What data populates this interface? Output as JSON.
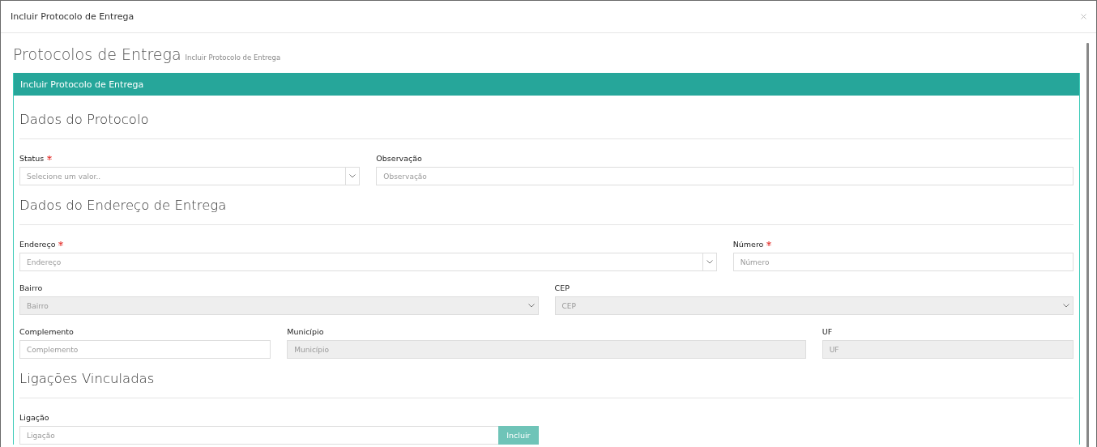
{
  "window": {
    "title": "Incluir Protocolo de Entrega"
  },
  "page": {
    "title": "Protocolos de Entrega",
    "subtitle": "Incluir Protocolo de Entrega"
  },
  "panel": {
    "title": "Incluir Protocolo de Entrega"
  },
  "sections": [
    {
      "title": "Dados do Protocolo",
      "fields": [
        {
          "label": "Status",
          "required": true,
          "kind": "select",
          "placeholder": "Selecione um valor..",
          "disabled": false
        },
        {
          "label": "Observação",
          "required": false,
          "kind": "text",
          "placeholder": "Observação",
          "disabled": false
        }
      ]
    },
    {
      "title": "Dados do Endereço de Entrega",
      "fields": [
        {
          "label": "Endereço",
          "required": true,
          "kind": "select",
          "placeholder": "Endereço",
          "disabled": false
        },
        {
          "label": "Número",
          "required": true,
          "kind": "text",
          "placeholder": "Número",
          "disabled": false
        },
        {
          "label": "Bairro",
          "required": false,
          "kind": "select",
          "placeholder": "Bairro",
          "disabled": true
        },
        {
          "label": "CEP",
          "required": false,
          "kind": "select",
          "placeholder": "CEP",
          "disabled": true
        },
        {
          "label": "Complemento",
          "required": false,
          "kind": "text",
          "placeholder": "Complemento",
          "disabled": false
        },
        {
          "label": "Município",
          "required": false,
          "kind": "text",
          "placeholder": "Município",
          "disabled": true
        },
        {
          "label": "UF",
          "required": false,
          "kind": "text",
          "placeholder": "UF",
          "disabled": true
        }
      ]
    },
    {
      "title": "Ligações Vinculadas",
      "fields": [
        {
          "label": "Ligação",
          "required": false,
          "kind": "input-button",
          "placeholder": "Ligação",
          "disabled": false,
          "button": "Incluir"
        }
      ]
    }
  ]
}
